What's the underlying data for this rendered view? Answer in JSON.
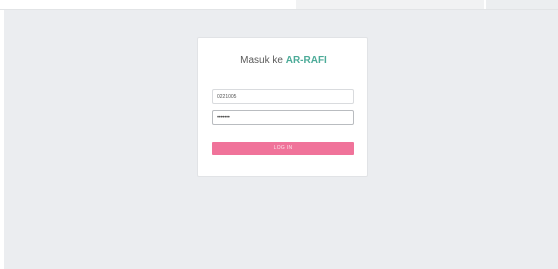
{
  "login": {
    "title_prefix": "Masuk ke ",
    "title_brand": "AR-RAFI",
    "username_value": "0221005",
    "password_value": "•••••••",
    "login_button_label": "LOG IN"
  },
  "colors": {
    "brand_accent": "#4cab98",
    "button_bg": "#f0739a",
    "page_bg": "#ebedf0"
  }
}
